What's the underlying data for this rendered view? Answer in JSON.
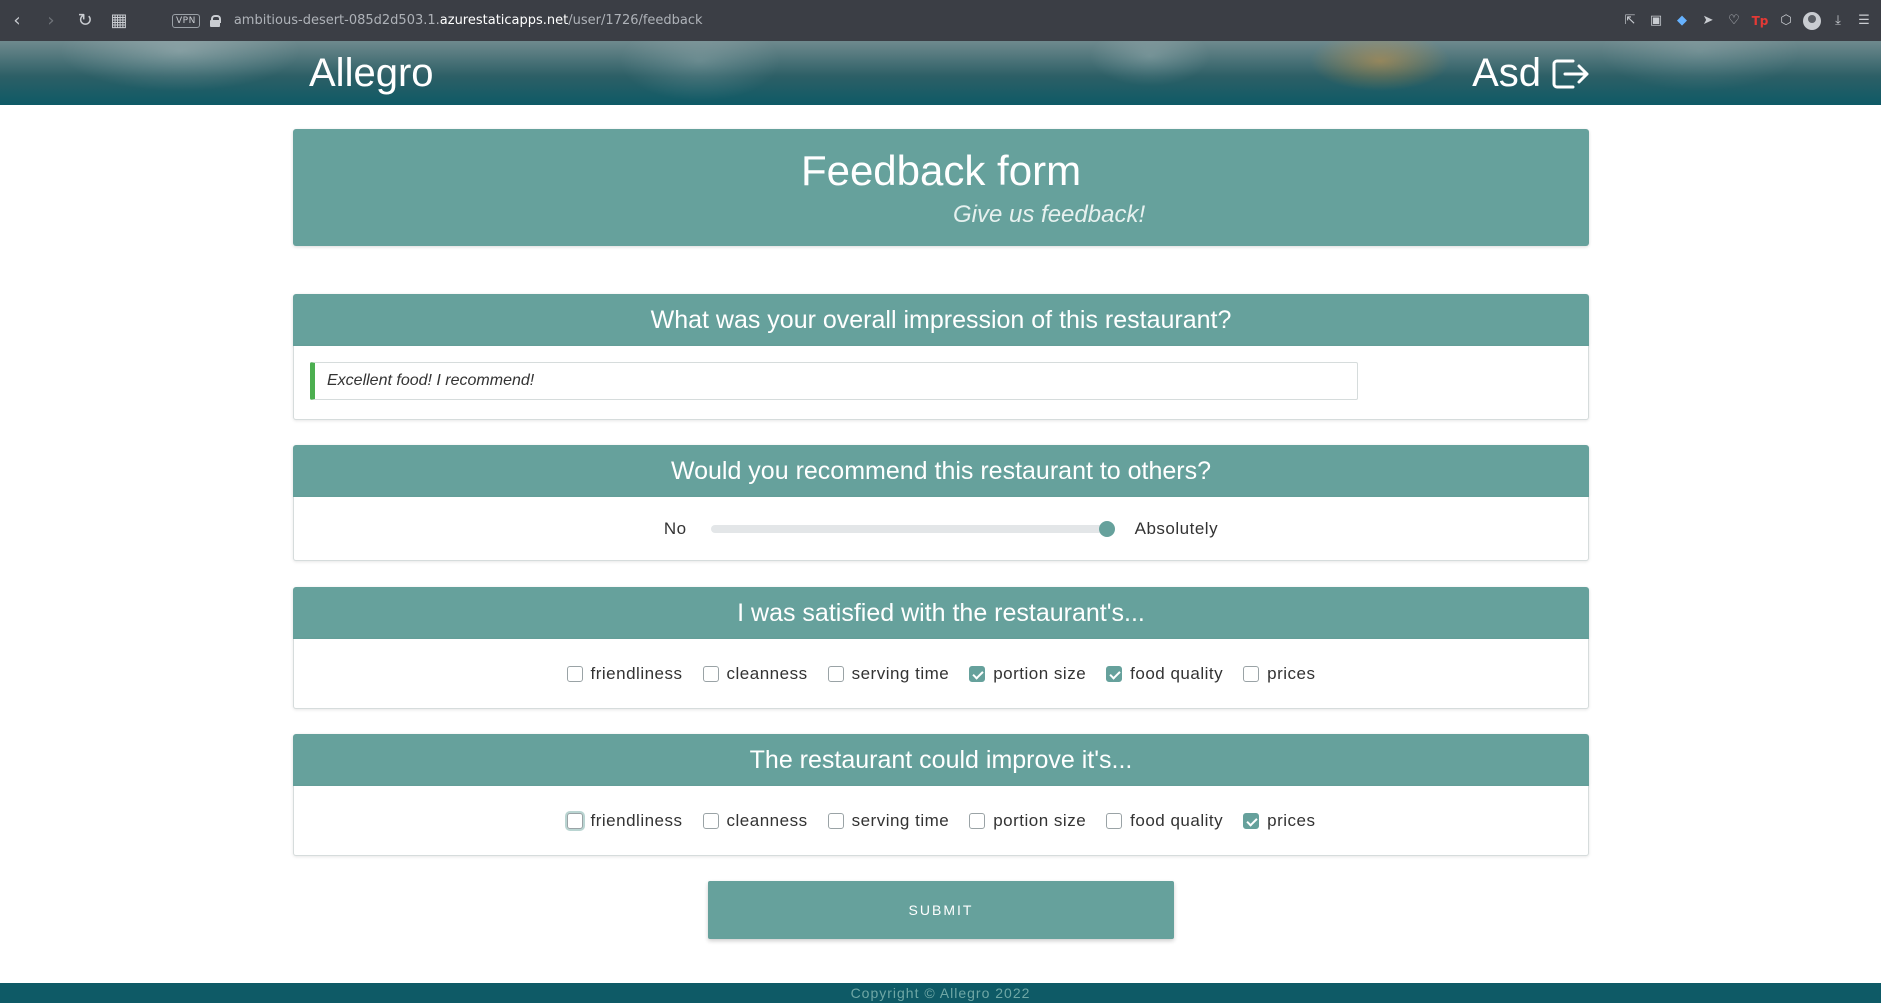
{
  "browser": {
    "vpn_label": "VPN",
    "url_prefix": "ambitious-desert-085d2d503.1.",
    "url_host": "azurestaticapps.net",
    "url_path": "/user/1726/feedback"
  },
  "header": {
    "brand": "Allegro",
    "user_name": "Asd"
  },
  "hero": {
    "title": "Feedback form",
    "subtitle": "Give us feedback!"
  },
  "questions": {
    "impression": {
      "title": "What was your overall impression of this restaurant?",
      "answer": "Excellent food! I recommend!"
    },
    "recommend": {
      "title": "Would you recommend this restaurant to others?",
      "min_label": "No",
      "max_label": "Absolutely",
      "value": 0.99
    },
    "satisfied": {
      "title": "I was satisfied with the restaurant's...",
      "options": [
        {
          "label": "friendliness",
          "checked": false
        },
        {
          "label": "cleanness",
          "checked": false
        },
        {
          "label": "serving time",
          "checked": false
        },
        {
          "label": "portion size",
          "checked": true
        },
        {
          "label": "food quality",
          "checked": true
        },
        {
          "label": "prices",
          "checked": false
        }
      ]
    },
    "improve": {
      "title": "The restaurant could improve it's...",
      "options": [
        {
          "label": "friendliness",
          "checked": false
        },
        {
          "label": "cleanness",
          "checked": false
        },
        {
          "label": "serving time",
          "checked": false
        },
        {
          "label": "portion size",
          "checked": false
        },
        {
          "label": "food quality",
          "checked": false
        },
        {
          "label": "prices",
          "checked": true
        }
      ]
    }
  },
  "submit_label": "SUBMIT",
  "footer": {
    "copyright": "Copyright © Allegro 2022"
  },
  "colors": {
    "accent": "#66a19c",
    "header_dark": "#0e5a66",
    "valid_green": "#4caf50"
  }
}
